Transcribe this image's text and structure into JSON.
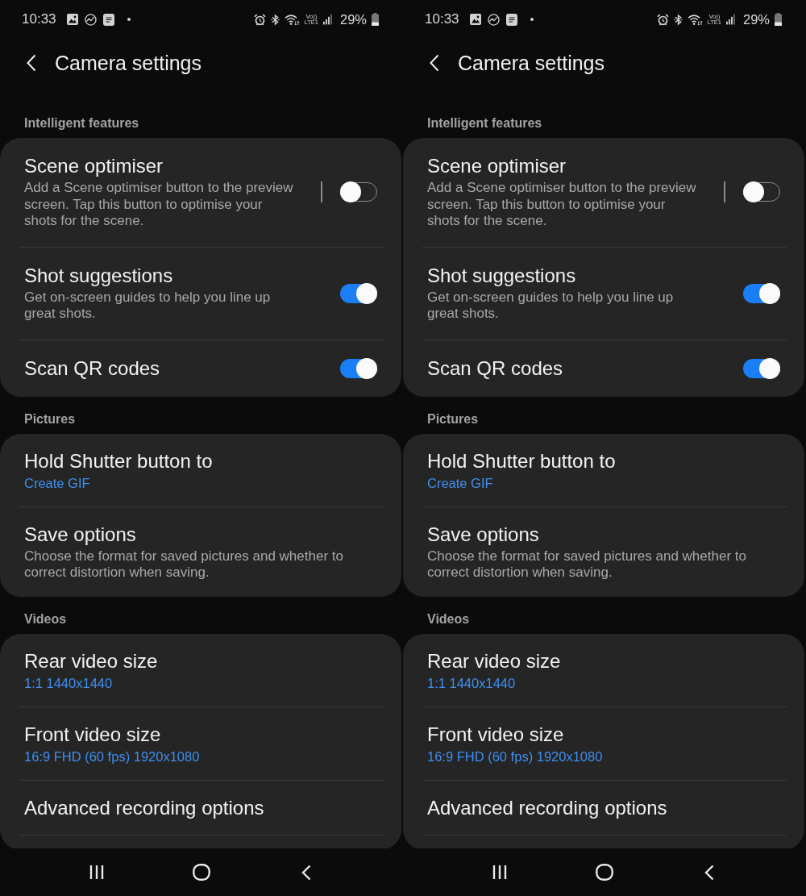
{
  "screens": [
    {
      "status_bar": {
        "time": "10:33",
        "network_top": "Vo))",
        "network_bottom": "LTE1",
        "battery": "29%"
      },
      "header": {
        "title": "Camera settings"
      },
      "sections": [
        {
          "title": "Intelligent features",
          "items": [
            {
              "kind": "splitswitch",
              "title": "Scene optimiser",
              "description": "Add a Scene optimiser button to the preview screen. Tap this button to optimise your shots for the scene.",
              "on": false
            },
            {
              "kind": "switch",
              "title": "Shot suggestions",
              "description": "Get on-screen guides to help you line up great shots.",
              "on": true
            },
            {
              "kind": "switch",
              "title": "Scan QR codes",
              "on": true
            }
          ]
        },
        {
          "title": "Pictures",
          "items": [
            {
              "kind": "link",
              "title": "Hold Shutter button to",
              "value": "Create GIF"
            },
            {
              "kind": "link",
              "title": "Save options",
              "description": "Choose the format for saved pictures and whether to correct distortion when saving."
            }
          ]
        },
        {
          "title": "Videos",
          "continues": true,
          "items": [
            {
              "kind": "link",
              "title": "Rear video size",
              "value": "1:1 1440x1440"
            },
            {
              "kind": "link",
              "title": "Front video size",
              "value": "16:9 FHD (60 fps) 1920x1080"
            },
            {
              "kind": "link",
              "title": "Advanced recording options"
            }
          ]
        }
      ]
    },
    {
      "status_bar": {
        "time": "10:33",
        "network_top": "Vo))",
        "network_bottom": "LTE1",
        "battery": "29%"
      },
      "header": {
        "title": "Camera settings"
      },
      "sections": [
        {
          "title": "Intelligent features",
          "items": [
            {
              "kind": "splitswitch",
              "title": "Scene optimiser",
              "description": "Add a Scene optimiser button to the preview screen. Tap this button to optimise your shots for the scene.",
              "on": false
            },
            {
              "kind": "switch",
              "title": "Shot suggestions",
              "description": "Get on-screen guides to help you line up great shots.",
              "on": true
            },
            {
              "kind": "switch",
              "title": "Scan QR codes",
              "on": true
            }
          ]
        },
        {
          "title": "Pictures",
          "items": [
            {
              "kind": "link",
              "title": "Hold Shutter button to",
              "value": "Create GIF"
            },
            {
              "kind": "link",
              "title": "Save options",
              "description": "Choose the format for saved pictures and whether to correct distortion when saving."
            }
          ]
        },
        {
          "title": "Videos",
          "continues": true,
          "items": [
            {
              "kind": "link",
              "title": "Rear video size",
              "value": "1:1 1440x1440"
            },
            {
              "kind": "link",
              "title": "Front video size",
              "value": "16:9 FHD (60 fps) 1920x1080"
            },
            {
              "kind": "link",
              "title": "Advanced recording options"
            }
          ]
        }
      ]
    }
  ]
}
